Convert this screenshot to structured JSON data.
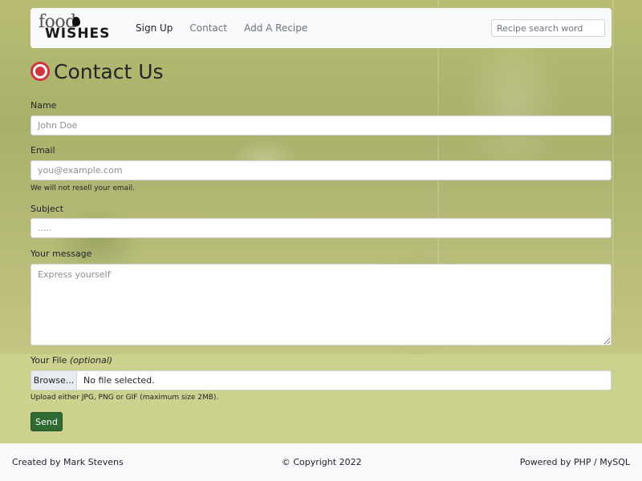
{
  "navbar": {
    "brand_top": "food",
    "brand_bottom": "WISHES",
    "links": [
      "Sign Up",
      "Contact",
      "Add A Recipe"
    ],
    "search_placeholder": "Recipe search word"
  },
  "page": {
    "title": "Contact Us",
    "title_icon": "plate-icon"
  },
  "form": {
    "name_label": "Name",
    "name_placeholder": "John Doe",
    "email_label": "Email",
    "email_placeholder": "you@example.com",
    "email_help": "We will not resell your email.",
    "subject_label": "Subject",
    "subject_placeholder": ".....",
    "message_label": "Your message",
    "message_placeholder": "Express yourself",
    "file_label": "Your File",
    "file_label_note": "(optional)",
    "file_button": "Browse...",
    "file_status": "No file selected.",
    "file_help": "Upload either JPG, PNG or GIF (maximum size 2MB).",
    "send_label": "Send"
  },
  "footer": {
    "left": "Created by Mark Stevens",
    "center": "© Copyright 2022",
    "right": "Powered by PHP / MySQL"
  },
  "colors": {
    "accent_red": "#d3333a",
    "send_green": "#2f6a33",
    "page_bg": "#cdd18e"
  }
}
